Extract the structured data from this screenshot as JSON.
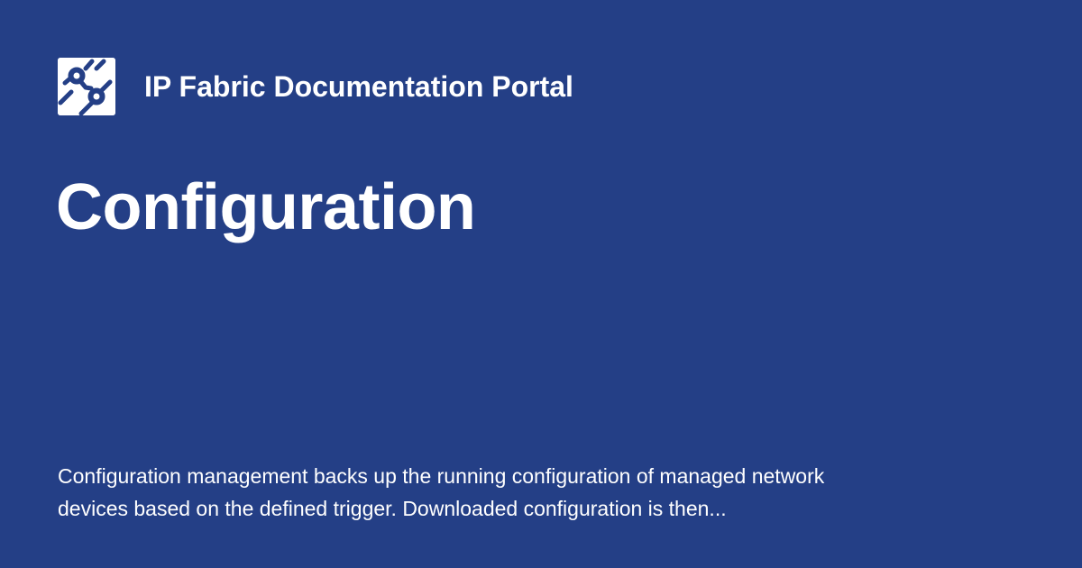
{
  "site": {
    "title": "IP Fabric Documentation Portal",
    "logo_icon": "ip-fabric-logo-icon"
  },
  "page": {
    "title": "Configuration",
    "description": "Configuration management backs up the running configuration of managed network devices based on the defined trigger. Downloaded configuration is then..."
  },
  "colors": {
    "background": "#243f86",
    "text": "#ffffff",
    "logo_background": "#ffffff",
    "logo_mark": "#243f86"
  }
}
